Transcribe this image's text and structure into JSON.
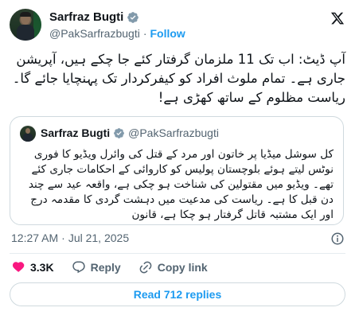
{
  "author": {
    "name": "Sarfraz Bugti",
    "handle": "@PakSarfrazbugti",
    "separator": "·",
    "follow_label": "Follow",
    "verified_color": "#829aab"
  },
  "tweet": {
    "text": "آپ ڈیٹ: اب تک 11 ملزمان گرفتار کئے جا چکے ہیں، آپریشن جاری ہے۔ تمام ملوث افراد کو کیفرکردار تک پہنچایا جائے گا۔ ریاست مظلوم کے ساتھ کھڑی ہے!"
  },
  "quoted": {
    "name": "Sarfraz Bugti",
    "handle": "@PakSarfrazbugti",
    "text": "کل سوشل میڈیا پر خاتون اور مرد کے قتل کی وائرل ویڈیو کا فوری نوٹس لیتے ہوئے بلوچستان پولیس کو کاروائی کے احکامات جاری کئے تھے۔ ویڈیو میں مقتولین کی شناخت ہو چکی ہے، واقعہ عید سے چند دن قبل کا ہے۔ ریاست کی مدعیت میں دہشت گردی کا مقدمہ درج اور ایک مشتبہ قاتل گرفتار ہو چکا ہے، قانون"
  },
  "meta": {
    "time": "12:27 AM",
    "separator": "·",
    "date": "Jul 21, 2025"
  },
  "actions": {
    "likes": "3.3K",
    "reply_label": "Reply",
    "copy_label": "Copy link"
  },
  "replies_button": "Read 712 replies",
  "colors": {
    "accent": "#1d9bf0",
    "like": "#f91880",
    "muted": "#536471"
  },
  "icons": [
    "verified-badge-icon",
    "x-logo-icon",
    "info-icon",
    "heart-icon",
    "reply-icon",
    "link-icon"
  ]
}
